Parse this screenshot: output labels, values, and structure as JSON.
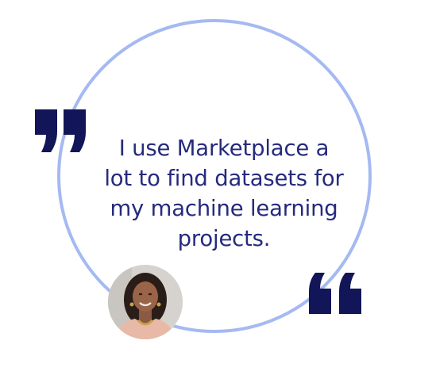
{
  "testimonial": {
    "quote": "I use Marketplace a lot to find datasets for my machine learning projects.",
    "lines": [
      "I use Marketplace a",
      "lot to find datasets for",
      "my machine learning",
      "projects."
    ]
  },
  "icons": {
    "open_quote": "open-quote-icon",
    "close_quote": "close-quote-icon"
  },
  "colors": {
    "text": "#262a7d",
    "ring": "#a5b9f2",
    "quote_marks": "#121557"
  }
}
